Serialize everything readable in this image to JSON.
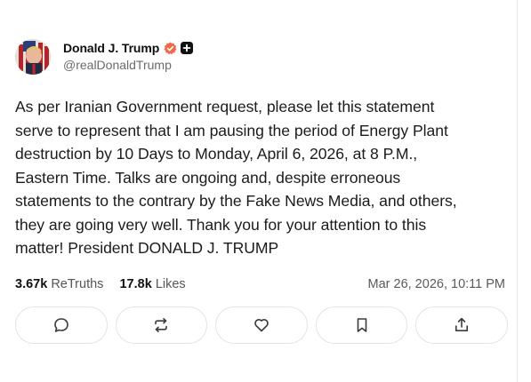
{
  "post": {
    "author": {
      "display_name": "Donald J. Trump",
      "handle": "@realDonaldTrump",
      "verified_icon": "verified-badge-icon",
      "plus_icon": "plus-badge-icon"
    },
    "text": "As per Iranian Government request, please let this statement\nserve to represent that I am pausing the period of Energy Plant\ndestruction by 10 Days to Monday, April 6, 2026, at 8 P.M.,\nEastern Time. Talks are ongoing and, despite erroneous\nstatements to the contrary by the Fake News Media, and others,\nthey are going very well. Thank you for your attention to this\nmatter! President DONALD J. TRUMP",
    "stats": {
      "retruths_count": "3.67k",
      "retruths_label": "ReTruths",
      "likes_count": "17.8k",
      "likes_label": "Likes"
    },
    "timestamp": "Mar 26, 2026, 10:11 PM"
  },
  "actions": [
    {
      "name": "reply",
      "icon": "comment-icon"
    },
    {
      "name": "retruth",
      "icon": "repost-icon"
    },
    {
      "name": "like",
      "icon": "heart-icon"
    },
    {
      "name": "bookmark",
      "icon": "bookmark-icon"
    },
    {
      "name": "share",
      "icon": "share-icon"
    }
  ],
  "colors": {
    "verified": "#f06a4a",
    "text": "#1b1b1b",
    "muted": "#6b6b6b",
    "border": "#e4e4e4"
  }
}
